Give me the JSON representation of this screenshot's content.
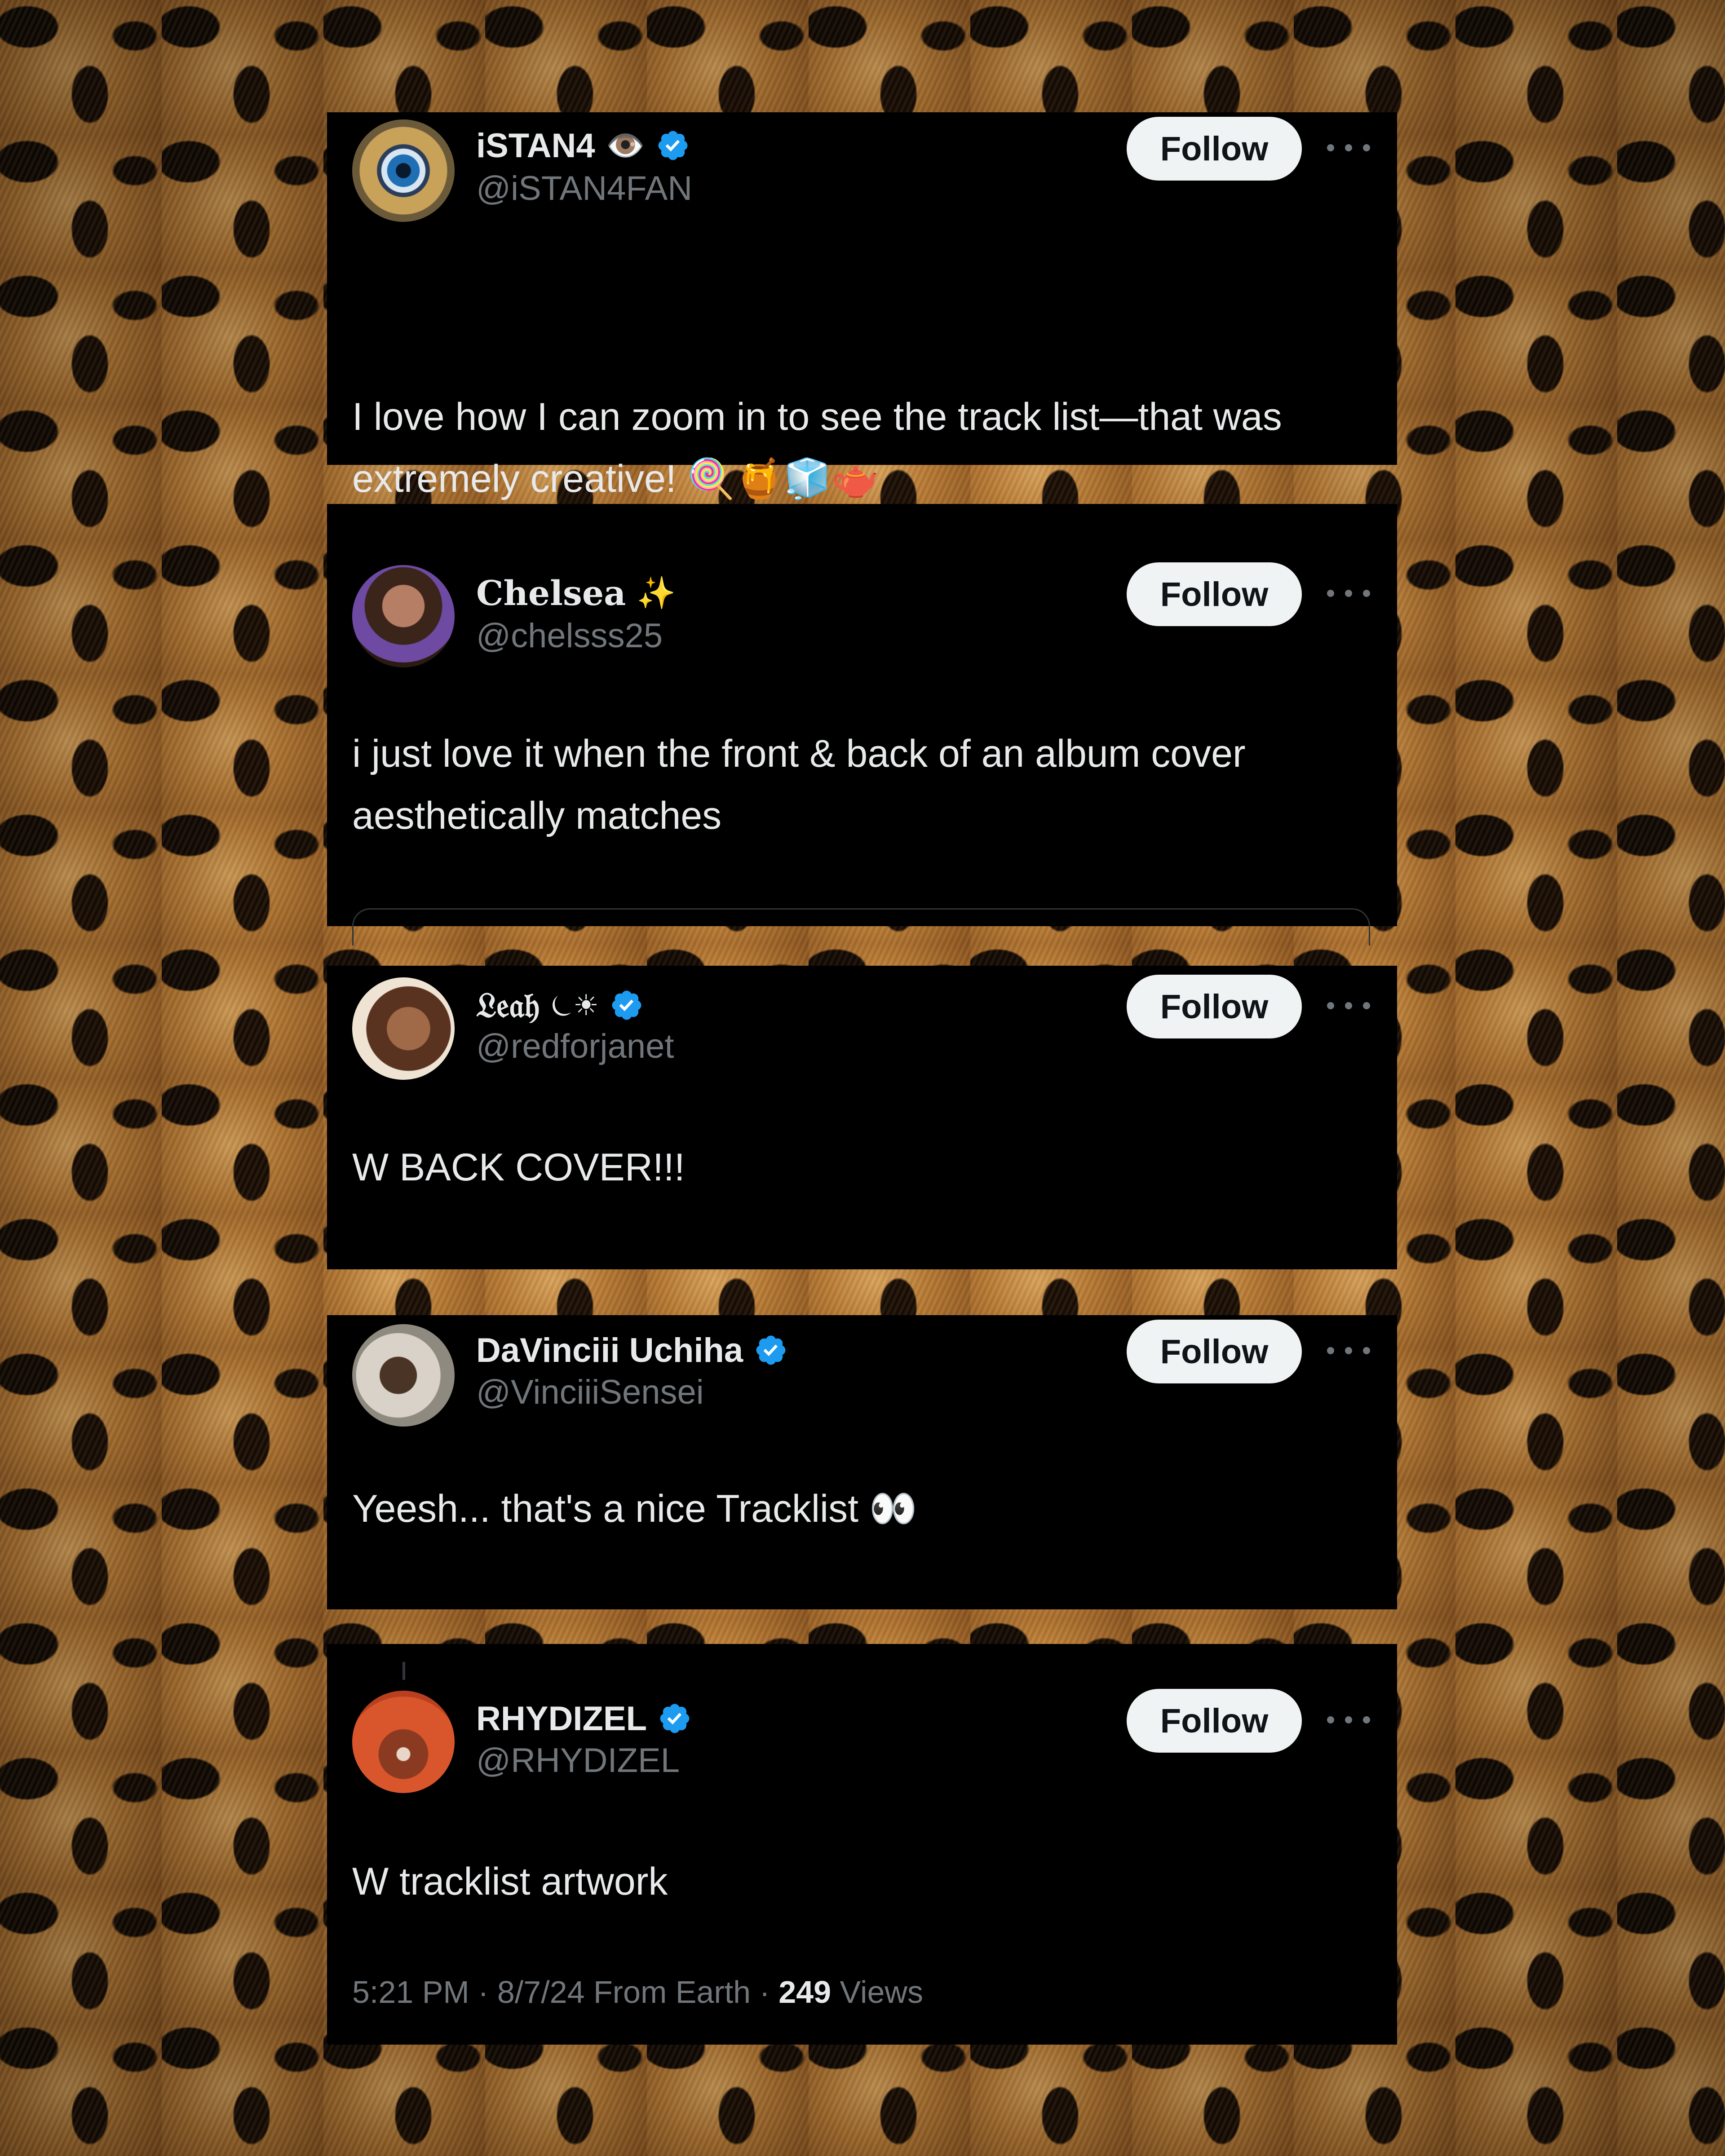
{
  "colors": {
    "card_bg": "#000000",
    "text_primary": "#e7e9ea",
    "text_secondary": "#71767b",
    "verified_blue": "#1d9bf0",
    "follow_bg": "#eff3f4"
  },
  "posts": [
    {
      "name": "iSTAN4",
      "name_emoji": "👁️",
      "verified": true,
      "handle": "@iSTAN4FAN",
      "follow_label": "Follow",
      "text": "I love how I can zoom in to see the track list—that was extremely creative! 🍭🍯🧊🫖",
      "avatar_icon": "eye-icon"
    },
    {
      "name": "Chelsea",
      "name_emoji": "✨",
      "verified": false,
      "handle": "@chelsss25",
      "follow_label": "Follow",
      "text": "i just love it when the front & back of an album cover aesthetically matches",
      "avatar_icon": "user-avatar"
    },
    {
      "name": "𝔏𝔢𝔞𝔥",
      "name_emoji": "⏾☀",
      "verified": true,
      "handle": "@redforjanet",
      "follow_label": "Follow",
      "text": "W BACK COVER!!!",
      "avatar_icon": "user-avatar"
    },
    {
      "name": "DaVinciii Uchiha",
      "name_emoji": "",
      "verified": true,
      "handle": "@VinciiiSensei",
      "follow_label": "Follow",
      "text": "Yeesh... that's a nice Tracklist 👀",
      "avatar_icon": "user-avatar"
    },
    {
      "name": "RHYDIZEL",
      "name_emoji": "",
      "verified": true,
      "handle": "@RHYDIZEL",
      "follow_label": "Follow",
      "text": "W tracklist artwork",
      "avatar_icon": "user-avatar",
      "meta_prefix": "5:21 PM · 8/7/24 From Earth · ",
      "meta_views_count": "249",
      "meta_views_label": " Views"
    }
  ]
}
